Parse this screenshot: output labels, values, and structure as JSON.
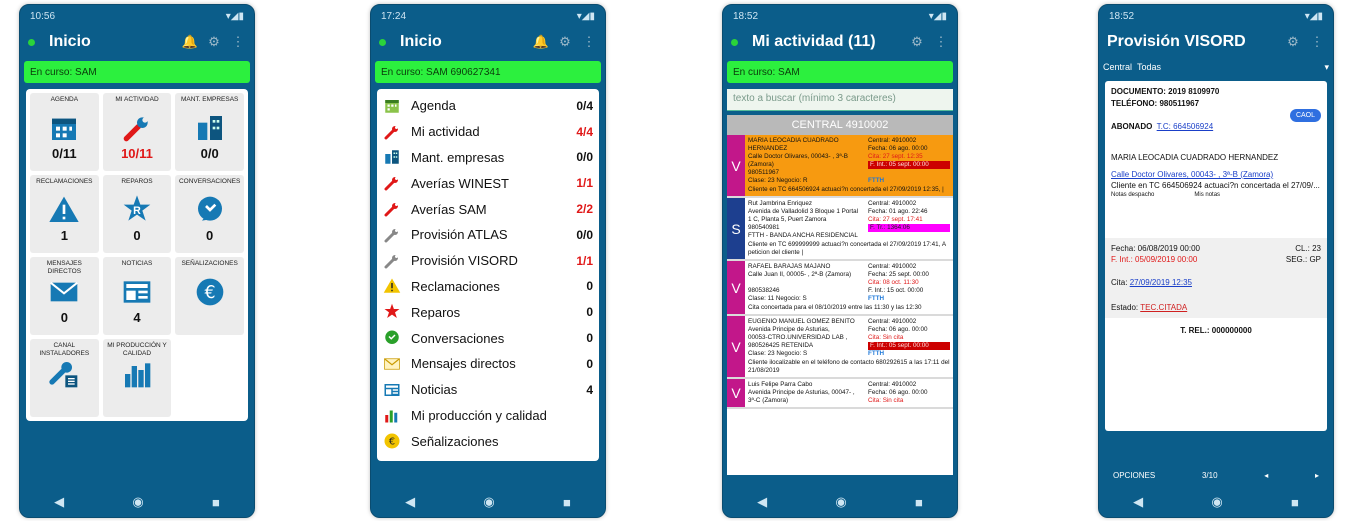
{
  "phone1": {
    "time": "10:56",
    "title": "Inicio",
    "status": "En curso: SAM",
    "tiles": [
      {
        "label": "AGENDA",
        "count": "0/11",
        "icon": "calendar-icon",
        "red": false
      },
      {
        "label": "MI ACTIVIDAD",
        "count": "10/11",
        "icon": "wrench-icon",
        "red": true
      },
      {
        "label": "MANT. EMPRESAS",
        "count": "0/0",
        "icon": "buildings-icon",
        "red": false
      },
      {
        "label": "RECLAMACIONES",
        "count": "1",
        "icon": "warning-icon",
        "red": false
      },
      {
        "label": "REPAROS",
        "count": "0",
        "icon": "repair-star-icon",
        "red": false
      },
      {
        "label": "CONVERSACIONES",
        "count": "0",
        "icon": "chat-icon",
        "red": false
      },
      {
        "label": "MENSAJES DIRECTOS",
        "count": "0",
        "icon": "envelope-icon",
        "red": false
      },
      {
        "label": "NOTICIAS",
        "count": "4",
        "icon": "news-icon",
        "red": false
      },
      {
        "label": "SEÑALIZACIONES",
        "count": "",
        "icon": "euro-icon",
        "red": false
      },
      {
        "label": "CANAL INSTALADORES",
        "count": "",
        "icon": "installer-icon",
        "red": false
      },
      {
        "label": "MI PRODUCCIÓN Y CALIDAD",
        "count": "",
        "icon": "bar-chart-icon",
        "red": false
      }
    ]
  },
  "phone2": {
    "time": "17:24",
    "title": "Inicio",
    "status": "En curso: SAM 690627341",
    "items": [
      {
        "label": "Agenda",
        "count": "0/4",
        "icon": "calendar-icon",
        "red": false
      },
      {
        "label": "Mi actividad",
        "count": "4/4",
        "icon": "wrench-icon",
        "red": true
      },
      {
        "label": "Mant. empresas",
        "count": "0/0",
        "icon": "buildings-icon",
        "red": false
      },
      {
        "label": "Averías WINEST",
        "count": "1/1",
        "icon": "wrench-red-icon",
        "red": true
      },
      {
        "label": "Averías SAM",
        "count": "2/2",
        "icon": "wrench-red-icon",
        "red": true
      },
      {
        "label": "Provisión ATLAS",
        "count": "0/0",
        "icon": "wrench-gray-icon",
        "red": false
      },
      {
        "label": "Provisión VISORD",
        "count": "1/1",
        "icon": "wrench-gray-icon",
        "red": true
      },
      {
        "label": "Reclamaciones",
        "count": "0",
        "icon": "warning-icon",
        "red": false
      },
      {
        "label": "Reparos",
        "count": "0",
        "icon": "repair-star-icon",
        "red": false
      },
      {
        "label": "Conversaciones",
        "count": "0",
        "icon": "chat-icon",
        "red": false
      },
      {
        "label": "Mensajes directos",
        "count": "0",
        "icon": "envelope-icon",
        "red": false
      },
      {
        "label": "Noticias",
        "count": "4",
        "icon": "news-icon",
        "red": false
      },
      {
        "label": "Mi producción y calidad",
        "count": "",
        "icon": "bar-chart-icon",
        "red": false
      },
      {
        "label": "Señalizaciones",
        "count": "",
        "icon": "euro-icon",
        "red": false
      }
    ]
  },
  "phone3": {
    "time": "18:52",
    "title": "Mi actividad (11)",
    "status": "En curso: SAM",
    "search_placeholder": "texto a buscar (mínimo 3 caracteres)",
    "central": "CENTRAL 4910002",
    "cards": [
      {
        "badge": "V",
        "color": "#f79a10",
        "badgeColor": "#c2178a",
        "left": [
          "MARIA LEOCADIA CUADRADO",
          "HERNANDEZ",
          "Calle Doctor Olivares, 00043- , 3ª-B",
          "(Zamora)",
          "980511967",
          "Clase: 23 Negocio: R"
        ],
        "right": [
          "Central: 4910002",
          "Fecha: 06 ago. 00:00",
          "Cita: 27 sept. 12:35",
          "F. Int.: 05 sept. 00:00",
          "",
          "FTTH"
        ],
        "note": "Cliente en TC 664506924 actuaci?n concertada el 27/09/2019 12:35, |"
      },
      {
        "badge": "S",
        "color": "#ffffff",
        "badgeColor": "#1d3f8f",
        "left": [
          "Rut Jambrina Enriquez",
          "Avenida de Valladolid 3 Bloque 1 Portal",
          "1 C, Planta 5, Puert Zamora",
          "980540981",
          "FTTH - BANDA ANCHA RESIDENCIAL"
        ],
        "right": [
          "Central: 4910002",
          "Fecha: 01 ago. 22:46",
          "Cita: 27 sept. 17:41",
          "F. Tr.: 1364:06",
          ""
        ],
        "note": "Cliente en TC 699999999 actuaci?n concertada el 27/09/2019 17:41, A peticion del cliente |"
      },
      {
        "badge": "V",
        "color": "#ffffff",
        "badgeColor": "#c2178a",
        "left": [
          "RAFAEL BARAJAS MAJANO",
          "Calle Juan II, 00005- , 2ª-B (Zamora)",
          "",
          "980538246",
          "Clase: 11 Negocio: S"
        ],
        "right": [
          "Central: 4910002",
          "Fecha: 25 sept. 00:00",
          "Cita: 08 oct. 11:30",
          "F. Int.: 15 oct. 00:00",
          "FTTH"
        ],
        "note": "Cita concertada para el 08/10/2019 entre las 11:30 y las 12:30"
      },
      {
        "badge": "V",
        "color": "#ffffff",
        "badgeColor": "#c2178a",
        "left": [
          "EUGENIO MANUEL GOMEZ BENITO",
          "Avenida Principe de Asturias,",
          "00053-CTRO.UNIVERSIDAD LAB ,",
          "980526425 RETENIDA",
          "Clase: 23 Negocio: S"
        ],
        "right": [
          "Central: 4910002",
          "Fecha: 06 ago. 00:00",
          "Cita: Sin cita",
          "F. Int.: 05 sept. 00:00",
          "FTTH"
        ],
        "note": "Cliente ilocalizable en el teléfono de contacto 680292615 a las 17:11 del 21/08/2019"
      },
      {
        "badge": "V",
        "color": "#ffffff",
        "badgeColor": "#c2178a",
        "left": [
          "Luis Felipe Parra Cabo",
          "Avenida Principe de Asturias, 00047- ,",
          "3ª-C (Zamora)"
        ],
        "right": [
          "Central: 4910002",
          "Fecha: 06 ago. 00:00",
          "Cita: Sin cita"
        ],
        "note": ""
      }
    ]
  },
  "phone4": {
    "time": "18:52",
    "title": "Provisión VISORD",
    "filter_label": "Central",
    "filter_value": "Todas",
    "documento": "DOCUMENTO: 2019 8109970",
    "telefono": "TELÉFONO: 980511967",
    "caol": "CAOL",
    "abonado_label": "ABONADO",
    "abonado_value": "T.C: 664506924",
    "name": "MARIA LEOCADIA CUADRADO HERNANDEZ",
    "address": "Calle Doctor Olivares, 00043- , 3ª-B (Zamora)",
    "note": "Cliente en TC 664506924 actuaci?n concertada el 27/09/...",
    "notas_despacho": "Notas despacho",
    "mis_notas": "Mis notas",
    "fecha": "Fecha: 06/08/2019 00:00",
    "cl": "CL.: 23",
    "fint": "F. Int.: 05/09/2019 00:00",
    "seg": "SEG.: GP",
    "cita_label": "Cita:",
    "cita_value": "27/09/2019 12:35",
    "estado_label": "Estado:",
    "estado_value": "TEC.CITADA",
    "trel": "T. REL.: 000000000",
    "opciones": "OPCIONES",
    "page": "3/10"
  }
}
